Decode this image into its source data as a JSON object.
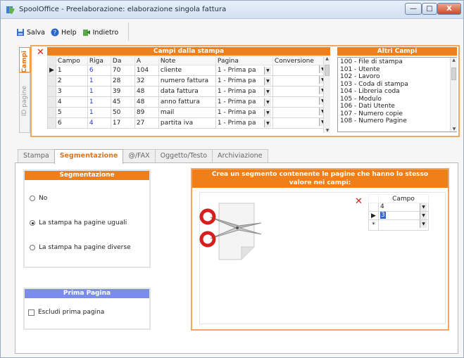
{
  "window": {
    "title": "SpoolOffice - Preelaborazione: elaborazione singola fattura",
    "buttons": {
      "minimize": "—",
      "maximize": "□",
      "close": "X"
    }
  },
  "toolbar": {
    "save_label": "Salva",
    "help_label": "Help",
    "back_label": "Indietro"
  },
  "side_tabs": {
    "campi": "Campi",
    "id_pagine": "ID pagine"
  },
  "campi_stampa": {
    "title": "Campi dalla stampa",
    "columns": [
      "Campo",
      "Riga",
      "Da",
      "A",
      "Note",
      "Pagina",
      "Conversione"
    ],
    "rows": [
      [
        "1",
        "6",
        "70",
        "104",
        "cliente",
        "1 - Prima pa",
        ""
      ],
      [
        "2",
        "1",
        "28",
        "32",
        "numero fattura",
        "1 - Prima pa",
        ""
      ],
      [
        "3",
        "1",
        "39",
        "48",
        "data fattura",
        "1 - Prima pa",
        ""
      ],
      [
        "4",
        "1",
        "45",
        "48",
        "anno fattura",
        "1 - Prima pa",
        ""
      ],
      [
        "5",
        "1",
        "50",
        "89",
        "mail",
        "1 - Prima pa",
        ""
      ],
      [
        "6",
        "4",
        "17",
        "27",
        "partita iva",
        "1 - Prima pa",
        ""
      ]
    ]
  },
  "altri_campi": {
    "title": "Altri Campi",
    "items": [
      "100 - File di stampa",
      "101 - Utente",
      "102 - Lavoro",
      "103 - Coda di stampa",
      "104 - Libreria coda",
      "105 - Modulo",
      "106 - Dati Utente",
      "107 - Numero copie",
      "108 - Numero Pagine"
    ]
  },
  "tabs": [
    "Stampa",
    "Segmentazione",
    "@/FAX",
    "Oggetto/Testo",
    "Archiviazione"
  ],
  "segmentazione": {
    "title": "Segmentazione",
    "options": [
      "No",
      "La stampa ha pagine uguali",
      "La stampa ha pagine diverse"
    ],
    "selected": 1
  },
  "prima_pagina": {
    "title": "Prima Pagina",
    "checkbox_label": "Escludi prima pagina"
  },
  "segmento": {
    "title_line1": "Crea un segmento contenente le pagine che hanno lo stesso",
    "title_line2": "valore nei campi:",
    "column": "Campo",
    "rows": [
      "4",
      "3",
      ""
    ]
  },
  "colors": {
    "accent_orange": "#f07f1a",
    "blue_header": "#7b8cf0",
    "delete_red": "#d82020"
  }
}
